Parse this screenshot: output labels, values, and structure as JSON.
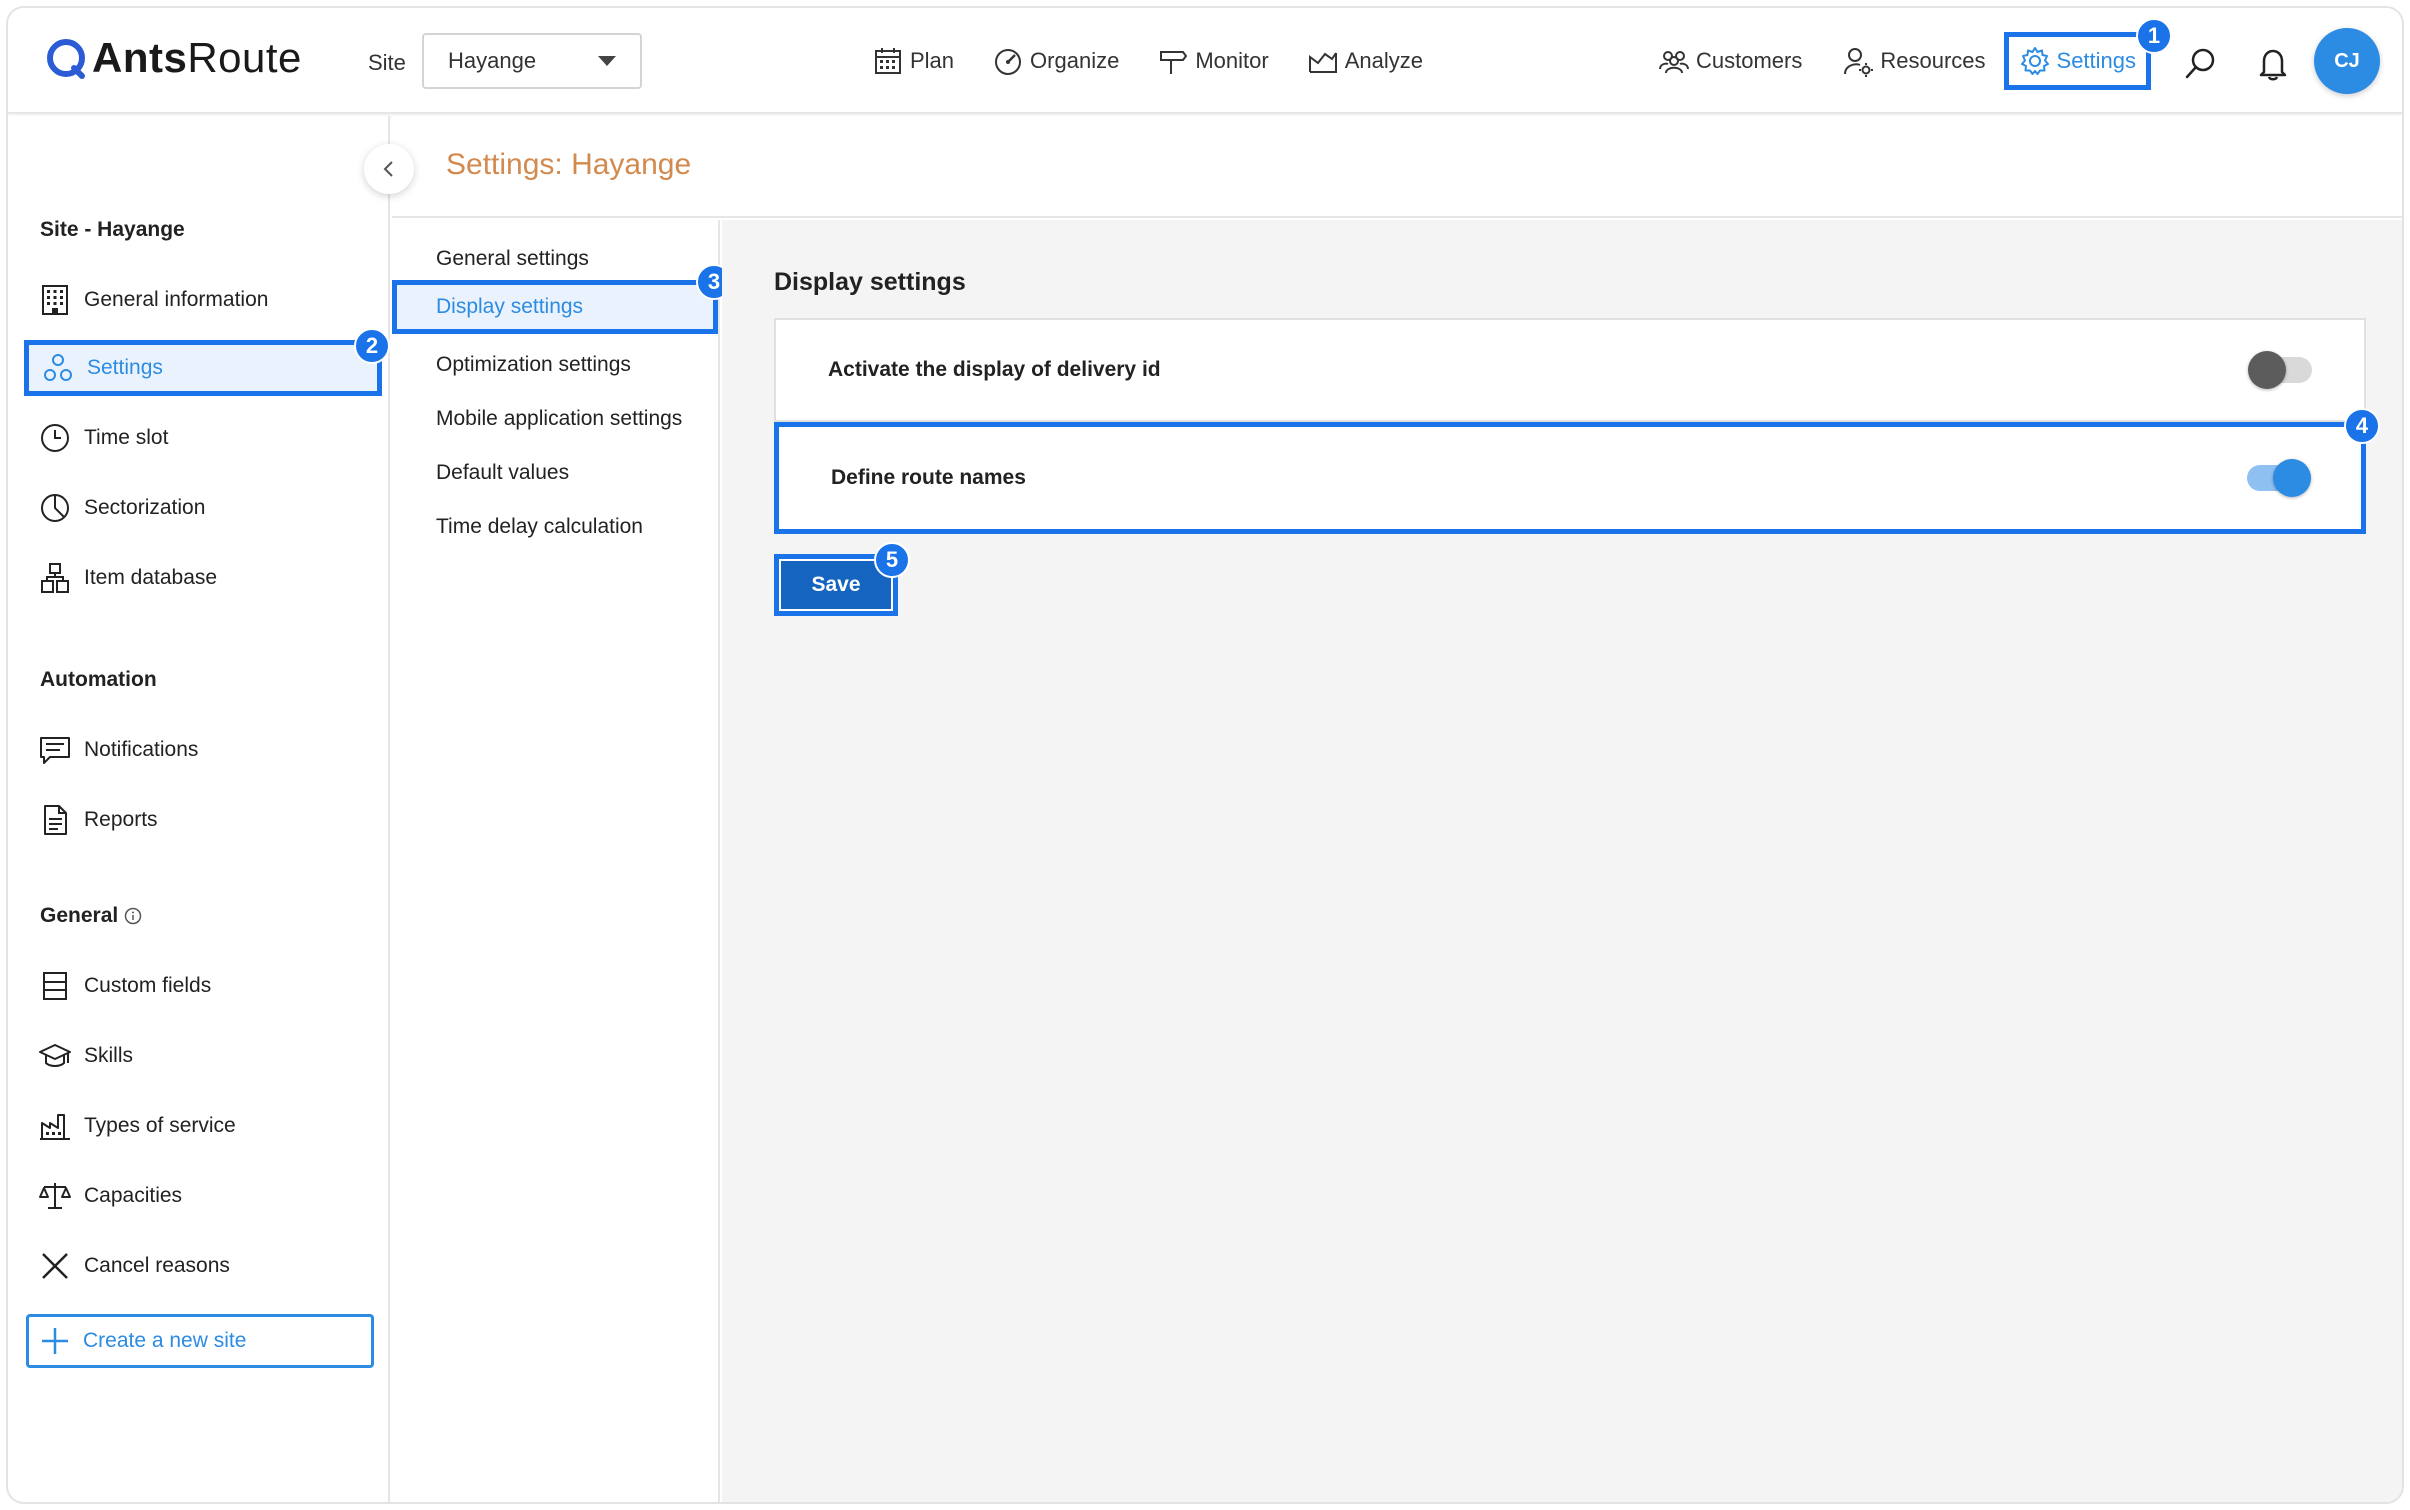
{
  "brand": {
    "name_bold": "Ants",
    "name_light": "Route"
  },
  "site": {
    "label": "Site",
    "selected": "Hayange"
  },
  "nav": {
    "plan": "Plan",
    "organize": "Organize",
    "monitor": "Monitor",
    "analyze": "Analyze",
    "customers": "Customers",
    "resources": "Resources",
    "settings": "Settings"
  },
  "user": {
    "initials": "CJ"
  },
  "badges": [
    "1",
    "2",
    "3",
    "4",
    "5"
  ],
  "sidebar": {
    "site_section": "Site - Hayange",
    "site_items": [
      "General information",
      "Settings",
      "Time slot",
      "Sectorization",
      "Item database"
    ],
    "automation_section": "Automation",
    "automation_items": [
      "Notifications",
      "Reports"
    ],
    "general_section": "General",
    "general_items": [
      "Custom fields",
      "Skills",
      "Types of service",
      "Capacities",
      "Cancel reasons"
    ],
    "create_site": "Create a new site"
  },
  "page": {
    "title": "Settings: Hayange"
  },
  "submenu": [
    "General settings",
    "Display settings",
    "Optimization settings",
    "Mobile application settings",
    "Default values",
    "Time delay calculation"
  ],
  "content": {
    "title": "Display settings",
    "rows": [
      {
        "label": "Activate the display of delivery id",
        "enabled": false
      },
      {
        "label": "Define route names",
        "enabled": true
      }
    ],
    "save_label": "Save"
  },
  "colors": {
    "accent": "#2c8be3",
    "highlight": "#1a73e8",
    "title": "#d28a4e",
    "save": "#1565c0"
  }
}
